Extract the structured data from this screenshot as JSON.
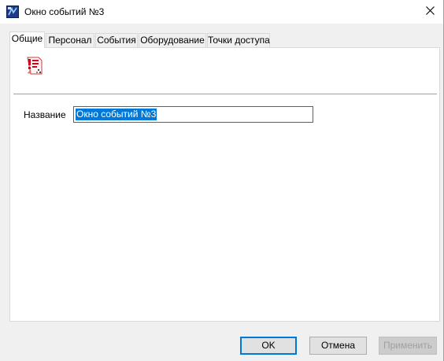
{
  "window": {
    "title": "Окно событий №3",
    "close_glyph": "✕",
    "icon": "app-icon"
  },
  "tabs": [
    {
      "label": "Общие",
      "active": true
    },
    {
      "label": "Персонал",
      "active": false
    },
    {
      "label": "События",
      "active": false
    },
    {
      "label": "Оборудование",
      "active": false
    },
    {
      "label": "Точки доступа",
      "active": false
    }
  ],
  "general": {
    "icon": "event-list-icon",
    "name_label": "Название",
    "name_value": "Окно событий №3"
  },
  "buttons": {
    "ok": "OK",
    "cancel": "Отмена",
    "apply": "Применить"
  },
  "colors": {
    "accent": "#0078d7",
    "icon_red": "#d0021b"
  }
}
